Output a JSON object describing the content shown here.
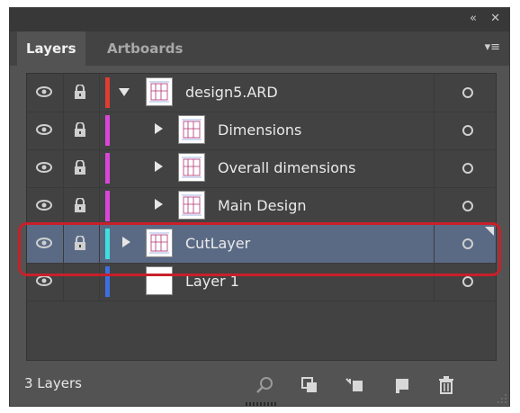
{
  "titlebar": {
    "collapse_icon": "«",
    "close_icon": "✕"
  },
  "tabs": [
    {
      "label": "Layers",
      "active": true
    },
    {
      "label": "Artboards",
      "active": false
    }
  ],
  "tab_menu_icon": "▾≡",
  "layers": [
    {
      "name": "design5.ARD",
      "color": "#e03c31",
      "expanded": true,
      "indent": 0,
      "locked": true,
      "visible": true,
      "selected": false
    },
    {
      "name": "Dimensions",
      "color": "#d946d9",
      "expanded": false,
      "indent": 1,
      "locked": true,
      "visible": true,
      "selected": false
    },
    {
      "name": "Overall dimensions",
      "color": "#d946d9",
      "expanded": false,
      "indent": 1,
      "locked": true,
      "visible": true,
      "selected": false
    },
    {
      "name": "Main Design",
      "color": "#d946d9",
      "expanded": false,
      "indent": 1,
      "locked": true,
      "visible": true,
      "selected": false
    },
    {
      "name": "CutLayer",
      "color": "#3ee0e0",
      "expanded": false,
      "indent": 0,
      "locked": true,
      "visible": true,
      "selected": true
    },
    {
      "name": "Layer 1",
      "color": "#3f6fe0",
      "expanded": null,
      "indent": 0,
      "locked": false,
      "visible": true,
      "selected": false
    }
  ],
  "footer": {
    "layer_count": "3 Layers",
    "icons": [
      "search-icon",
      "make-clipping-mask-icon",
      "create-sublayer-icon",
      "new-layer-icon",
      "delete-icon"
    ]
  },
  "colors": {
    "panel_bg": "#535353",
    "selected_row": "#5a6a85",
    "highlight": "#c8202a"
  }
}
